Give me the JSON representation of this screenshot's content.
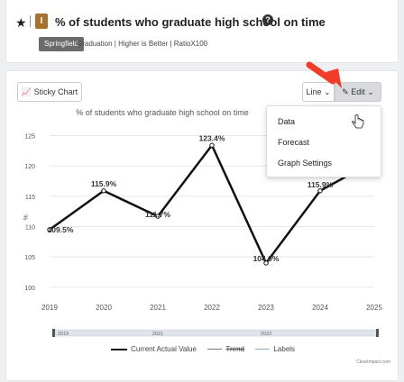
{
  "header": {
    "title": "% of students who graduate high school on time",
    "badge_letter": "I",
    "tag": "Springfield",
    "meta": "Graduation | Higher is Better | RatioX100"
  },
  "toolbar": {
    "sticky_label": "Sticky Chart",
    "chart_type_label": "Line",
    "edit_label": "Edit"
  },
  "menu": {
    "items": [
      "Data",
      "Forecast",
      "Graph Settings"
    ]
  },
  "legend": {
    "actual": "Current Actual Value",
    "trend": "Trend",
    "labels": "Labels"
  },
  "credit": "ClearImpact.com",
  "chart_data": {
    "type": "line",
    "title": "% of students who graduate high school on time",
    "ylabel": "%",
    "xlabel": "",
    "x": [
      "2019",
      "2020",
      "2021",
      "2022",
      "2023",
      "2024",
      "2025"
    ],
    "series": [
      {
        "name": "Current Actual Value",
        "values": [
          109.5,
          115.9,
          111.7,
          123.4,
          104.0,
          115.9,
          120.8
        ]
      }
    ],
    "data_labels": [
      "109.5%",
      "115.9%",
      "111.7%",
      "123.4%",
      "104.0%",
      "115.9%",
      null
    ],
    "yticks": [
      100,
      105,
      110,
      115,
      120,
      125
    ],
    "ylim": [
      98.5,
      127
    ],
    "range_slider_labels": [
      "2019",
      "2021",
      "2023"
    ],
    "grid": true,
    "legend_position": "bottom",
    "colors": {
      "line": "#111111",
      "grid": "#e6e6e6"
    }
  }
}
